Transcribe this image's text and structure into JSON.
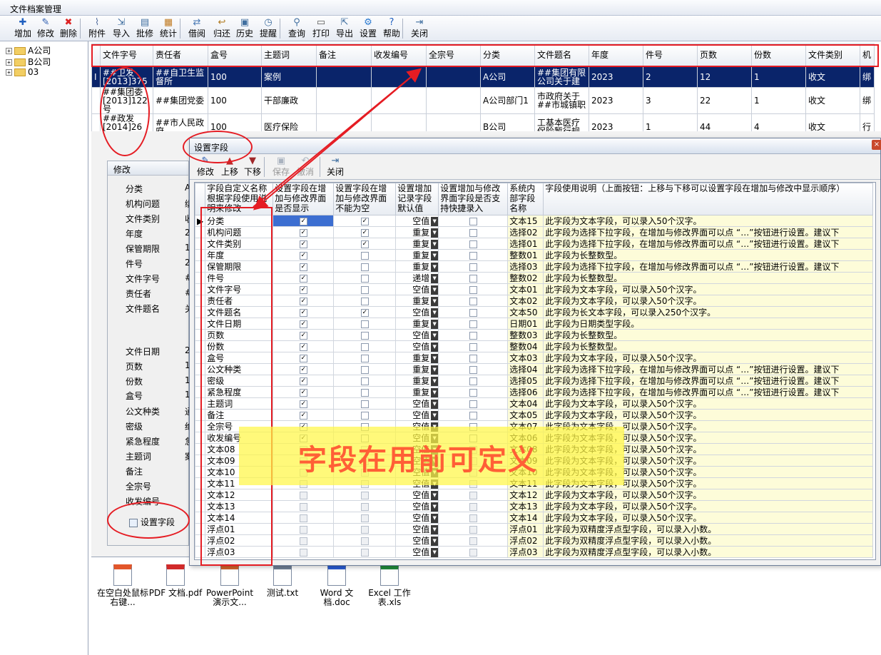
{
  "window": {
    "title": "文件档案管理"
  },
  "toolbar": [
    {
      "label": "增加",
      "icon": "plus-icon",
      "color": "#1f5fbf"
    },
    {
      "label": "修改",
      "icon": "pencil-icon",
      "color": "#2a5ab0"
    },
    {
      "label": "删除",
      "icon": "x-icon",
      "color": "#d22"
    },
    {
      "label": "附件",
      "icon": "paperclip-icon",
      "color": "#5670a0"
    },
    {
      "label": "导入",
      "icon": "import-icon",
      "color": "#3f6e9f"
    },
    {
      "label": "批修",
      "icon": "batch-edit-icon",
      "color": "#3f6e9f"
    },
    {
      "label": "统计",
      "icon": "stats-icon",
      "color": "#c07a20"
    },
    {
      "label": "借阅",
      "icon": "borrow-icon",
      "color": "#4a7ab5"
    },
    {
      "label": "归还",
      "icon": "return-icon",
      "color": "#b07a20"
    },
    {
      "label": "历史",
      "icon": "history-icon",
      "color": "#3f6e9f"
    },
    {
      "label": "提醒",
      "icon": "clock-icon",
      "color": "#3f6e9f"
    },
    {
      "label": "查询",
      "icon": "search-icon",
      "color": "#3f6e9f"
    },
    {
      "label": "打印",
      "icon": "printer-icon",
      "color": "#555"
    },
    {
      "label": "导出",
      "icon": "export-icon",
      "color": "#3f6e9f"
    },
    {
      "label": "设置",
      "icon": "gear-icon",
      "color": "#2a7ad0"
    },
    {
      "label": "帮助",
      "icon": "help-icon",
      "color": "#1f5fbf"
    },
    {
      "label": "关闭",
      "icon": "exit-icon",
      "color": "#3f6e9f"
    }
  ],
  "tree": [
    {
      "label": "A公司"
    },
    {
      "label": "B公司"
    },
    {
      "label": "03"
    }
  ],
  "grid": {
    "columns": [
      "文件字号",
      "责任者",
      "盒号",
      "主题词",
      "备注",
      "收发编号",
      "全宗号",
      "分类",
      "文件题名",
      "年度",
      "件号",
      "页数",
      "份数",
      "文件类别",
      "机"
    ],
    "rows": [
      {
        "marker": "I",
        "cells": [
          "##卫发[2013]375",
          "##自卫生监督所",
          "100",
          "案例",
          "",
          "",
          "",
          "A公司",
          "##集团有限公司关于建",
          "2023",
          "2",
          "12",
          "1",
          "收文",
          "绑"
        ]
      },
      {
        "marker": "",
        "cells": [
          "##集团委[2013]122号",
          "##集团党委",
          "100",
          "干部廉政",
          "",
          "",
          "",
          "A公司部门1",
          "市政府关于##市城镇职",
          "2023",
          "3",
          "22",
          "1",
          "收文",
          "绑"
        ]
      },
      {
        "marker": "",
        "cells": [
          "##政发[2014]26号",
          "##市人民政府",
          "100",
          "医疗保险",
          "",
          "",
          "",
          "B公司",
          "工基本医疗保险暂行规",
          "2023",
          "1",
          "44",
          "4",
          "收文",
          "行"
        ]
      }
    ]
  },
  "edit_panel": {
    "title": "修改",
    "labels": [
      "分类",
      "机构问题",
      "文件类别",
      "年度",
      "保管期限",
      "件号",
      "文件字号",
      "责任者",
      "文件题名",
      "文件日期",
      "页数",
      "份数",
      "盒号",
      "公文种类",
      "密级",
      "紧急程度",
      "主题词",
      "备注",
      "全宗号",
      "收发编号"
    ],
    "values": [
      "A",
      "绑",
      "收",
      "2",
      "1",
      "2",
      "#",
      "#",
      "关",
      "2",
      "1",
      "1",
      "1",
      "通",
      "绝",
      "急",
      "案",
      "",
      "",
      ""
    ],
    "set_fields_button": "设置字段"
  },
  "dialog": {
    "title": "设置字段",
    "close": "×",
    "toolbar": [
      {
        "label": "修改",
        "icon": "pencil-icon",
        "enabled": true
      },
      {
        "label": "上移",
        "icon": "arrow-up-icon",
        "enabled": true
      },
      {
        "label": "下移",
        "icon": "arrow-down-icon",
        "enabled": true
      },
      {
        "label": "保存",
        "icon": "save-icon",
        "enabled": false
      },
      {
        "label": "撤消",
        "icon": "undo-icon",
        "enabled": false
      },
      {
        "label": "关闭",
        "icon": "exit-icon",
        "enabled": true
      }
    ],
    "columns": [
      "字段自定义名称根据字段使用说明来修改",
      "设置字段在增加与修改界面是否显示",
      "设置字段在增加与修改界面不能为空",
      "设置增加记录字段默认值",
      "设置增加与修改界面字段是否支持快捷录入",
      "系统内部字段名称",
      "字段使用说明（上面按钮：上移与下移可以设置字段在增加与修改中显示顺序）"
    ],
    "rows": [
      {
        "name": "分类",
        "show": true,
        "req": true,
        "def": "空值",
        "quick": false,
        "sys": "文本15",
        "desc": "此字段为文本字段，可以录入50个汉字。"
      },
      {
        "name": "机构问题",
        "show": true,
        "req": true,
        "def": "重复",
        "quick": false,
        "sys": "选择02",
        "desc": "此字段为选择下拉字段，在增加与修改界面可以点 “…”按钮进行设置。建议下"
      },
      {
        "name": "文件类别",
        "show": true,
        "req": true,
        "def": "重复",
        "quick": false,
        "sys": "选择01",
        "desc": "此字段为选择下拉字段，在增加与修改界面可以点 “…”按钮进行设置。建议下"
      },
      {
        "name": "年度",
        "show": true,
        "req": false,
        "def": "重复",
        "quick": false,
        "sys": "整数01",
        "desc": "此字段为长整数型。"
      },
      {
        "name": "保管期限",
        "show": true,
        "req": false,
        "def": "重复",
        "quick": false,
        "sys": "选择03",
        "desc": "此字段为选择下拉字段，在增加与修改界面可以点 “…”按钮进行设置。建议下"
      },
      {
        "name": "件号",
        "show": true,
        "req": false,
        "def": "递增",
        "quick": false,
        "sys": "整数02",
        "desc": "此字段为长整数型。"
      },
      {
        "name": "文件字号",
        "show": true,
        "req": false,
        "def": "空值",
        "quick": false,
        "sys": "文本01",
        "desc": "此字段为文本字段，可以录入50个汉字。"
      },
      {
        "name": "责任者",
        "show": true,
        "req": false,
        "def": "重复",
        "quick": false,
        "sys": "文本02",
        "desc": "此字段为文本字段，可以录入50个汉字。"
      },
      {
        "name": "文件题名",
        "show": true,
        "req": true,
        "def": "空值",
        "quick": false,
        "sys": "文本50",
        "desc": "此字段为长文本字段，可以录入250个汉字。"
      },
      {
        "name": "文件日期",
        "show": true,
        "req": false,
        "def": "重复",
        "quick": false,
        "sys": "日期01",
        "desc": "此字段为日期类型字段。"
      },
      {
        "name": "页数",
        "show": true,
        "req": false,
        "def": "空值",
        "quick": false,
        "sys": "整数03",
        "desc": "此字段为长整数型。"
      },
      {
        "name": "份数",
        "show": true,
        "req": false,
        "def": "空值",
        "quick": false,
        "sys": "整数04",
        "desc": "此字段为长整数型。"
      },
      {
        "name": "盒号",
        "show": true,
        "req": false,
        "def": "重复",
        "quick": false,
        "sys": "文本03",
        "desc": "此字段为文本字段，可以录入50个汉字。"
      },
      {
        "name": "公文种类",
        "show": true,
        "req": false,
        "def": "重复",
        "quick": false,
        "sys": "选择04",
        "desc": "此字段为选择下拉字段，在增加与修改界面可以点 “…”按钮进行设置。建议下"
      },
      {
        "name": "密级",
        "show": true,
        "req": false,
        "def": "重复",
        "quick": false,
        "sys": "选择05",
        "desc": "此字段为选择下拉字段，在增加与修改界面可以点 “…”按钮进行设置。建议下"
      },
      {
        "name": "紧急程度",
        "show": true,
        "req": false,
        "def": "重复",
        "quick": false,
        "sys": "选择06",
        "desc": "此字段为选择下拉字段，在增加与修改界面可以点 “…”按钮进行设置。建议下"
      },
      {
        "name": "主题词",
        "show": true,
        "req": false,
        "def": "空值",
        "quick": false,
        "sys": "文本04",
        "desc": "此字段为文本字段，可以录入50个汉字。"
      },
      {
        "name": "备注",
        "show": true,
        "req": false,
        "def": "空值",
        "quick": false,
        "sys": "文本05",
        "desc": "此字段为文本字段，可以录入50个汉字。"
      },
      {
        "name": "全宗号",
        "show": true,
        "req": false,
        "def": "空值",
        "quick": false,
        "sys": "文本07",
        "desc": "此字段为文本字段，可以录入50个汉字。"
      },
      {
        "name": "收发编号",
        "show": true,
        "req": false,
        "def": "空值",
        "quick": false,
        "sys": "文本06",
        "desc": "此字段为文本字段，可以录入50个汉字。"
      },
      {
        "name": "文本08",
        "show": false,
        "req": false,
        "def": "空值",
        "quick": false,
        "sys": "文本08",
        "desc": "此字段为文本字段，可以录入50个汉字。"
      },
      {
        "name": "文本09",
        "show": false,
        "req": false,
        "def": "空值",
        "quick": false,
        "sys": "文本09",
        "desc": "此字段为文本字段，可以录入50个汉字。"
      },
      {
        "name": "文本10",
        "show": false,
        "req": false,
        "def": "空值",
        "quick": false,
        "sys": "文本10",
        "desc": "此字段为文本字段，可以录入50个汉字。"
      },
      {
        "name": "文本11",
        "show": false,
        "req": false,
        "def": "空值",
        "quick": false,
        "sys": "文本11",
        "desc": "此字段为文本字段，可以录入50个汉字。"
      },
      {
        "name": "文本12",
        "show": false,
        "req": false,
        "def": "空值",
        "quick": false,
        "sys": "文本12",
        "desc": "此字段为文本字段，可以录入50个汉字。"
      },
      {
        "name": "文本13",
        "show": false,
        "req": false,
        "def": "空值",
        "quick": false,
        "sys": "文本13",
        "desc": "此字段为文本字段，可以录入50个汉字。"
      },
      {
        "name": "文本14",
        "show": false,
        "req": false,
        "def": "空值",
        "quick": false,
        "sys": "文本14",
        "desc": "此字段为文本字段，可以录入50个汉字。"
      },
      {
        "name": "浮点01",
        "show": false,
        "req": false,
        "def": "空值",
        "quick": false,
        "sys": "浮点01",
        "desc": "此字段为双精度浮点型字段，可以录入小数。"
      },
      {
        "name": "浮点02",
        "show": false,
        "req": false,
        "def": "空值",
        "quick": false,
        "sys": "浮点02",
        "desc": "此字段为双精度浮点型字段，可以录入小数。"
      },
      {
        "name": "浮点03",
        "show": false,
        "req": false,
        "def": "空值",
        "quick": false,
        "sys": "浮点03",
        "desc": "此字段为双精度浮点型字段，可以录入小数。"
      }
    ]
  },
  "attachments": [
    {
      "label": "在空白处鼠标右键...",
      "icon": "folder-image-icon",
      "color": "#e2562a"
    },
    {
      "label": "PDF 文档.pdf",
      "icon": "pdf-icon",
      "color": "#d12a2a"
    },
    {
      "label": "PowerPoint 演示文...",
      "icon": "ppt-icon",
      "color": "#d2632a"
    },
    {
      "label": "测试.txt",
      "icon": "txt-icon",
      "color": "#6f7f95"
    },
    {
      "label": "Word 文档.doc",
      "icon": "word-icon",
      "color": "#2a5bd1"
    },
    {
      "label": "Excel 工作表.xls",
      "icon": "excel-icon",
      "color": "#1f8a3a"
    }
  ],
  "annotation": {
    "text": "字段在用前可定义"
  }
}
